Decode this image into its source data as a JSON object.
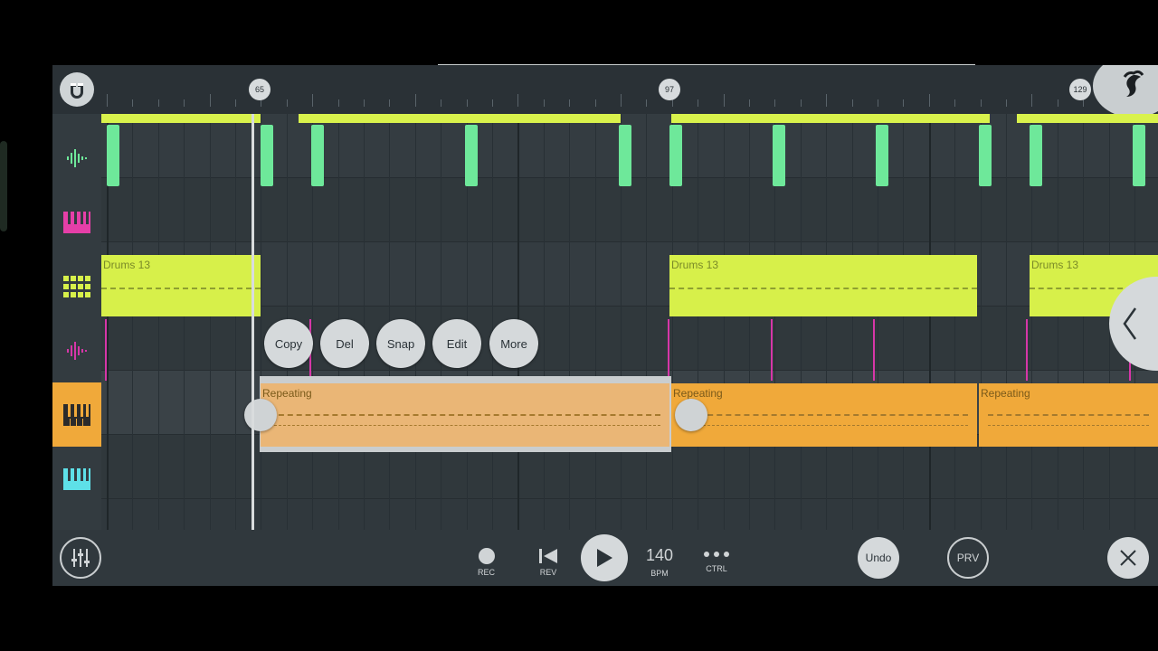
{
  "ruler": {
    "markers": [
      "65",
      "97",
      "129"
    ]
  },
  "tracks": [
    {
      "icon": "waveform-icon",
      "color": "#6ee89a"
    },
    {
      "icon": "piano-keys-icon",
      "color": "#e63fa8"
    },
    {
      "icon": "drum-pads-icon",
      "color": "#d7f04a"
    },
    {
      "icon": "waveform-icon",
      "color": "#d636a8"
    },
    {
      "icon": "piano-keys-icon",
      "color": "#f0a93a",
      "selected": true
    },
    {
      "icon": "piano-keys-icon",
      "color": "#5ee0e8"
    }
  ],
  "clips": {
    "drums_label": "Drums 13",
    "repeating_label": "Repeating"
  },
  "context_menu": [
    "Copy",
    "Del",
    "Snap",
    "Edit",
    "More"
  ],
  "transport": {
    "rec_label": "REC",
    "rev_label": "REV",
    "tempo_value": "140",
    "tempo_label": "BPM",
    "ctrl_label": "CTRL",
    "undo_label": "Undo",
    "prv_label": "PRV"
  },
  "colors": {
    "accent_green": "#6ee89a",
    "accent_lime": "#d7f04a",
    "accent_orange": "#f0a93a",
    "accent_pink": "#d636a8"
  }
}
